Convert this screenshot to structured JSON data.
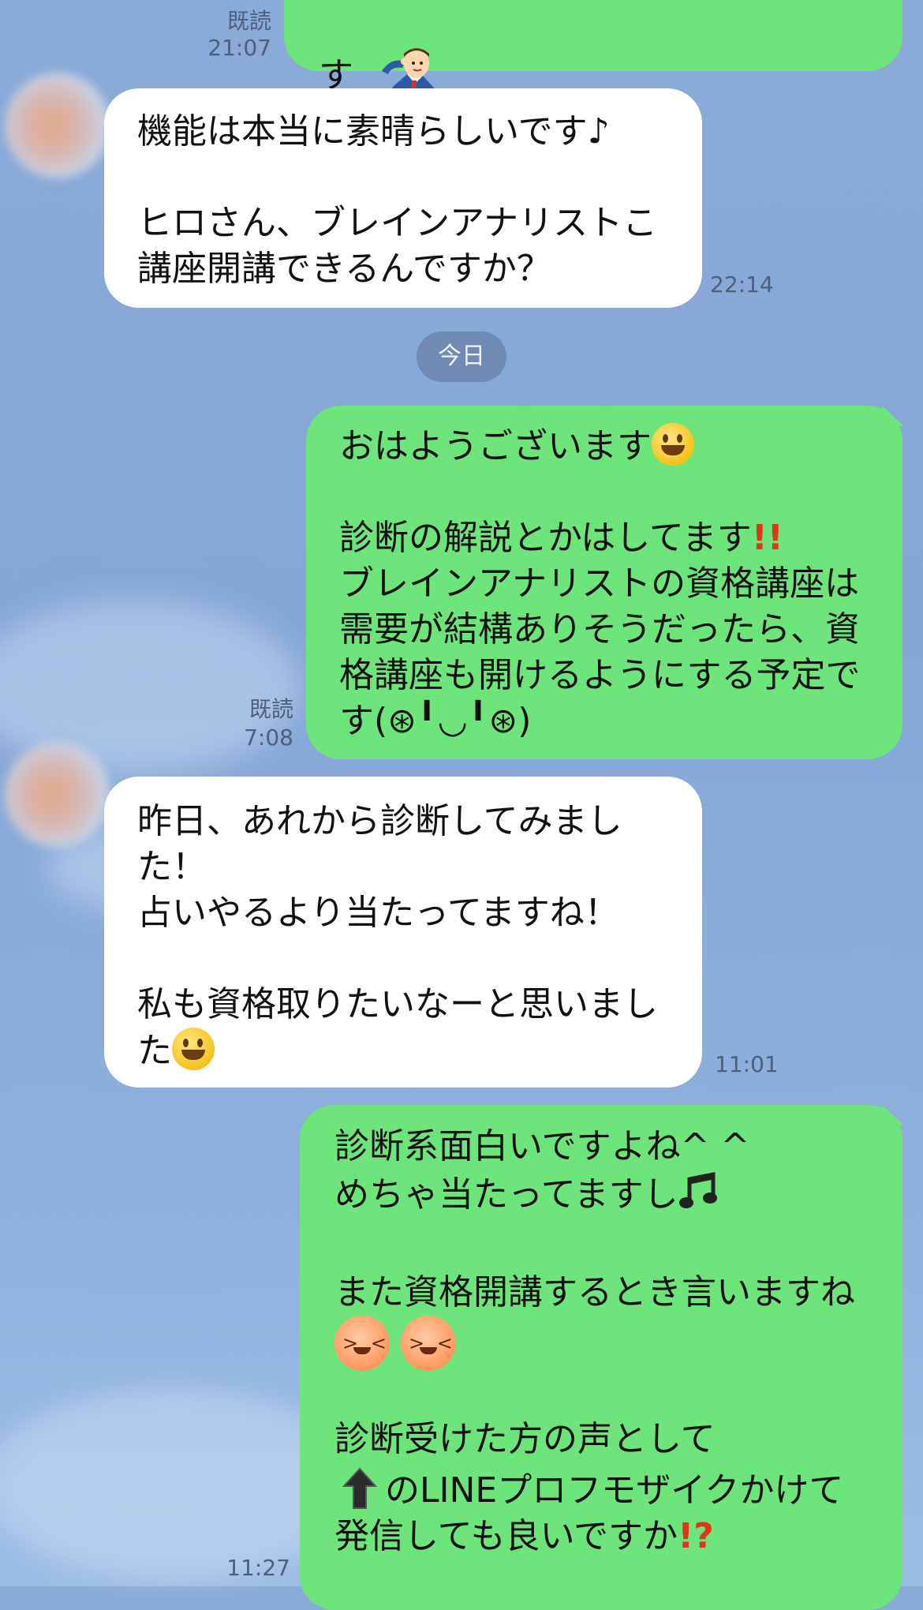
{
  "chat": {
    "date_separator": "今日",
    "messages": [
      {
        "id": "m1",
        "direction": "outgoing",
        "text": "す",
        "trailing_icon": "saluting-businessman-sticker",
        "read_label": "既読",
        "time": "21:07"
      },
      {
        "id": "m2",
        "direction": "incoming",
        "lines": [
          "機能は本当に素晴らしいです♪",
          "",
          "ヒロさん、ブレインアナリストこ",
          "講座開講できるんですか？"
        ],
        "time": "22:14"
      },
      {
        "id": "m3",
        "direction": "outgoing",
        "lines": [
          "おはようございます",
          "",
          "診断の解説とかはしてます",
          "ブレインアナリストの資格講座は",
          "需要が結構ありそうだったら、資",
          "格講座も開けるようにする予定で",
          "す(⊛╹◡╹⊛)"
        ],
        "emoji": [
          "grinning-face-icon",
          "double-exclamation-icon"
        ],
        "read_label": "既読",
        "time": "7:08"
      },
      {
        "id": "m4",
        "direction": "incoming",
        "lines": [
          "昨日、あれから診断してみまし",
          "た！",
          "占いやるより当たってますね！",
          "",
          "私も資格取りたいなーと思いまし",
          "た"
        ],
        "emoji": [
          "smiling-face-icon"
        ],
        "time": "11:01"
      },
      {
        "id": "m5",
        "direction": "outgoing",
        "lines": [
          "診断系面白いですよね^ ^",
          "めちゃ当たってますし",
          "",
          "また資格開講するとき言いますね",
          "",
          "",
          "診断受けた方の声として",
          "のLINEプロフモザイクかけて",
          "発信しても良いですか"
        ],
        "emoji": [
          "music-note-icon",
          "blushing-face-icon",
          "blushing-face-icon",
          "up-arrow-icon",
          "exclamation-question-icon"
        ],
        "time": "11:27"
      }
    ]
  }
}
